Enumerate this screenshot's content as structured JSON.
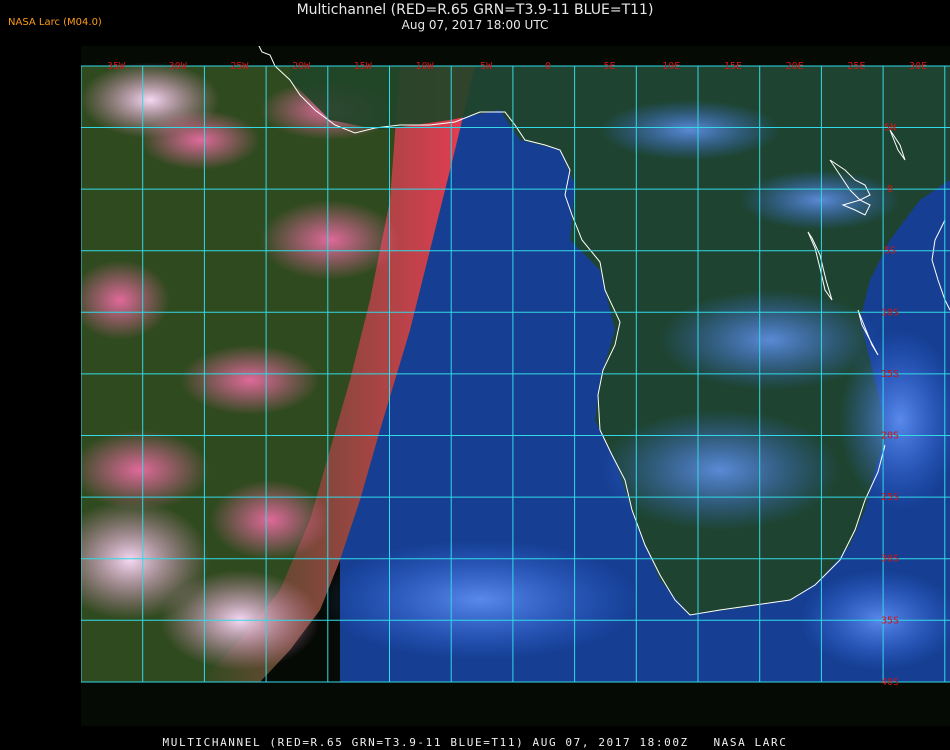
{
  "badge": "NASA Larc (M04.0)",
  "title": "Multichannel (RED=R.65 GRN=T3.9-11 BLUE=T11)",
  "subtitle": "Aug 07, 2017 18:00 UTC",
  "footer": "MULTICHANNEL (RED=R.65 GRN=T3.9-11 BLUE=T11) AUG 07, 2017 18:00Z   NASA LARC",
  "grid": {
    "longitudes": [
      "35W",
      "30W",
      "25W",
      "20W",
      "15W",
      "10W",
      "5W",
      "0",
      "5E",
      "10E",
      "15E",
      "20E",
      "25E",
      "30E",
      "35E"
    ],
    "latitudes": [
      "5N",
      "0",
      "5S",
      "10S",
      "15S",
      "20S",
      "25S",
      "30S",
      "35S",
      "40S"
    ]
  },
  "colors": {
    "grid": "#33d9e6",
    "labels": "#d01414",
    "coast": "#ffffff",
    "badge": "#ff9a1a",
    "night_pink": "#e85aa0",
    "night_green": "#2f4a1e",
    "day_ocean": "#163f93",
    "day_cloud": "#3d76ff",
    "land": "#1f4428"
  }
}
